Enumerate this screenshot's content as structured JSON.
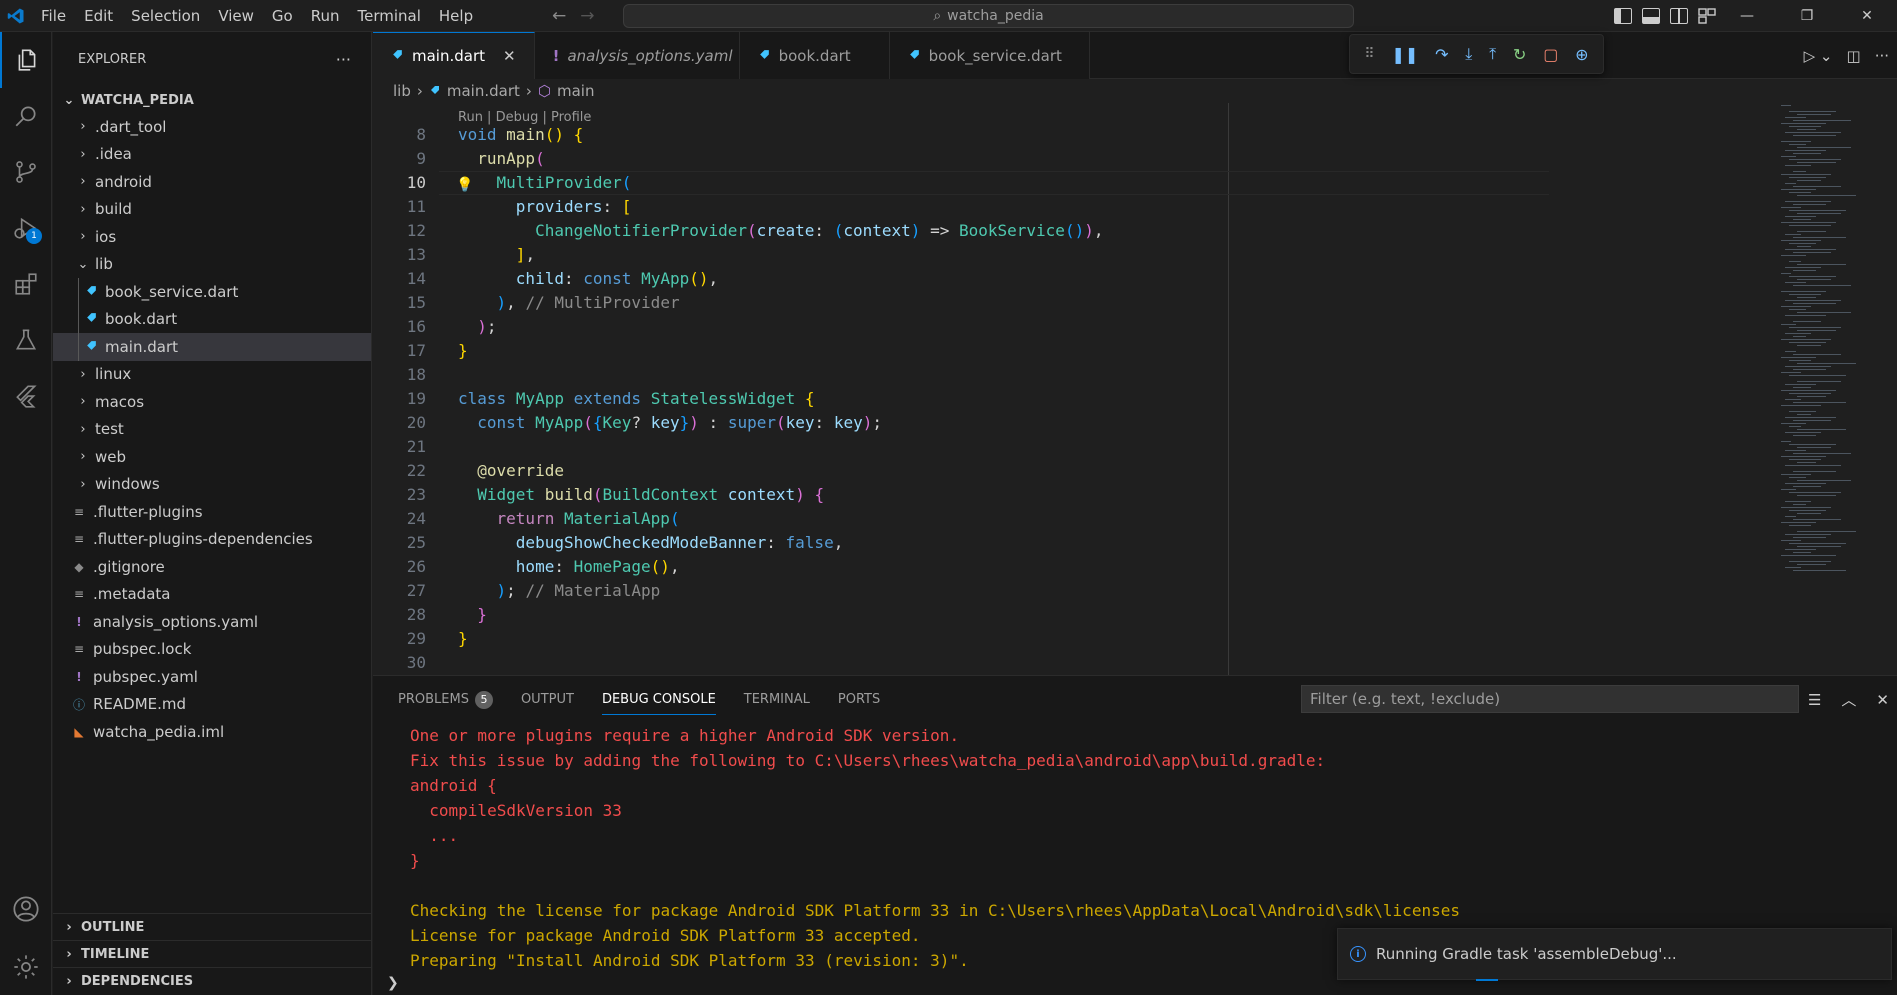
{
  "titlebar": {
    "menu": [
      "File",
      "Edit",
      "Selection",
      "View",
      "Go",
      "Run",
      "Terminal",
      "Help"
    ],
    "search": "watcha_pedia"
  },
  "colors": {
    "accent": "#0078d4",
    "error": "#f14c4c",
    "warning": "#cca700",
    "bg": "#1f1f1f",
    "sidebar_bg": "#181818"
  },
  "activity": {
    "run_debug_badge": "1"
  },
  "explorer": {
    "header": "EXPLORER",
    "more": "···",
    "folder": "WATCHA_PEDIA",
    "items": [
      {
        "label": ".dart_tool",
        "type": "folder"
      },
      {
        "label": ".idea",
        "type": "folder"
      },
      {
        "label": "android",
        "type": "folder"
      },
      {
        "label": "build",
        "type": "folder"
      },
      {
        "label": "ios",
        "type": "folder"
      },
      {
        "label": "lib",
        "type": "folder-open"
      },
      {
        "label": "book_service.dart",
        "type": "dart"
      },
      {
        "label": "book.dart",
        "type": "dart"
      },
      {
        "label": "main.dart",
        "type": "dart"
      },
      {
        "label": "linux",
        "type": "folder"
      },
      {
        "label": "macos",
        "type": "folder"
      },
      {
        "label": "test",
        "type": "folder"
      },
      {
        "label": "web",
        "type": "folder"
      },
      {
        "label": "windows",
        "type": "folder"
      },
      {
        "label": ".flutter-plugins",
        "type": "lines"
      },
      {
        "label": ".flutter-plugins-dependencies",
        "type": "lines"
      },
      {
        "label": ".gitignore",
        "type": "git"
      },
      {
        "label": ".metadata",
        "type": "lines"
      },
      {
        "label": "analysis_options.yaml",
        "type": "yaml"
      },
      {
        "label": "pubspec.lock",
        "type": "lines"
      },
      {
        "label": "pubspec.yaml",
        "type": "yaml"
      },
      {
        "label": "README.md",
        "type": "info"
      },
      {
        "label": "watcha_pedia.iml",
        "type": "rss"
      }
    ],
    "sections": [
      "OUTLINE",
      "TIMELINE",
      "DEPENDENCIES"
    ]
  },
  "tabs": [
    {
      "label": "main.dart",
      "active": true,
      "close": "✕"
    },
    {
      "label": "analysis_options.yaml",
      "active": false
    },
    {
      "label": "book.dart",
      "active": false
    },
    {
      "label": "book_service.dart",
      "active": false
    }
  ],
  "breadcrumb": [
    "lib",
    "main.dart",
    "main"
  ],
  "codelens": "Run | Debug | Profile",
  "code_lines": [
    "8",
    "9",
    "10",
    "11",
    "12",
    "13",
    "14",
    "15",
    "16",
    "17",
    "18",
    "19",
    "20",
    "21",
    "22",
    "23",
    "24",
    "25",
    "26",
    "27",
    "28",
    "29",
    "30"
  ],
  "panel": {
    "tabs": [
      "PROBLEMS",
      "OUTPUT",
      "DEBUG CONSOLE",
      "TERMINAL",
      "PORTS"
    ],
    "problems_count": "5",
    "filter_placeholder": "Filter (e.g. text, !exclude)",
    "console": [
      {
        "text": "One or more plugins require a higher Android SDK version.",
        "level": "err"
      },
      {
        "text": "Fix this issue by adding the following to C:\\Users\\rhees\\watcha_pedia\\android\\app\\build.gradle:",
        "level": "err"
      },
      {
        "text": "android {",
        "level": "err"
      },
      {
        "text": "  compileSdkVersion 33",
        "level": "err"
      },
      {
        "text": "  ...",
        "level": "err"
      },
      {
        "text": "}",
        "level": "err"
      },
      {
        "text": "",
        "level": "err"
      },
      {
        "text": "Checking the license for package Android SDK Platform 33 in C:\\Users\\rhees\\AppData\\Local\\Android\\sdk\\licenses",
        "level": "warn"
      },
      {
        "text": "License for package Android SDK Platform 33 accepted.",
        "level": "warn"
      },
      {
        "text": "Preparing \"Install Android SDK Platform 33 (revision: 3)\".",
        "level": "warn"
      }
    ]
  },
  "notification": {
    "text": "Running Gradle task 'assembleDebug'..."
  }
}
